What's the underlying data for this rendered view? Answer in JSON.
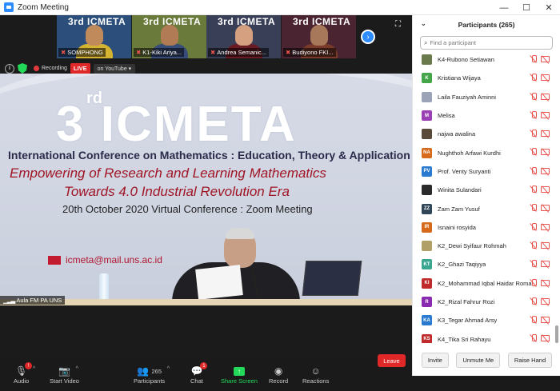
{
  "window": {
    "title": "Zoom Meeting",
    "min": "—",
    "max": "☐",
    "close": "✕"
  },
  "thumbnails": [
    {
      "name": "SOMPHONG",
      "bg": "#2b4f7a",
      "face": "#c08a5a",
      "body": "#d4b232"
    },
    {
      "name": "K1-Kiki Ariya...",
      "bg": "#6a7a3a",
      "face": "#b07b55",
      "body": "#384c7a"
    },
    {
      "name": "Andrea Semanic...",
      "bg": "#3a3f58",
      "face": "#d4a080",
      "body": "#6a1a22"
    },
    {
      "name": "Budiyono FKI...",
      "bg": "#4a2430",
      "face": "#a8785a",
      "body": "#7a3a2a"
    }
  ],
  "thumb_logo": "3rd ICMETA",
  "recording": {
    "label": "Recording",
    "live": "LIVE",
    "stream": "on YouTube"
  },
  "slide": {
    "big": "3",
    "sup": "rd",
    "brand": "ICMETA",
    "line1": "International Conference on Mathematics : Education, Theory & Application",
    "line2": "Empowering of Research and Learning Mathematics",
    "line3": "Towards 4.0 Industrial Revolution Era",
    "line4": "20th October 2020  Virtual Conference : Zoom Meeting",
    "email": "icmeta@mail.uns.ac.id"
  },
  "speaker_tag": "Aula FM PA UNS",
  "toolbar": {
    "audio": "Audio",
    "audio_badge": "!",
    "video": "Start Video",
    "participants": "Participants",
    "participants_count": "265",
    "chat": "Chat",
    "chat_badge": "1",
    "share": "Share Screen",
    "record": "Record",
    "reactions": "Reactions",
    "leave": "Leave"
  },
  "panel": {
    "title": "Participants (265)",
    "search_placeholder": "Find a participant",
    "participants": [
      {
        "name": "K4-Rubono Setiawan",
        "initials": "",
        "color": "#6a7a4a"
      },
      {
        "name": "Kristiana Wijaya",
        "initials": "K",
        "color": "#44a648"
      },
      {
        "name": "Laila Fauziyah Aminni",
        "initials": "",
        "color": "#9aa3b8"
      },
      {
        "name": "Melisa",
        "initials": "M",
        "color": "#9b3fb5"
      },
      {
        "name": "najwa awalina",
        "initials": "",
        "color": "#5a4a3a"
      },
      {
        "name": "Nughthoh Arfawi Kurdhi",
        "initials": "NA",
        "color": "#d66a1a"
      },
      {
        "name": "Prof. Venty Suryanti",
        "initials": "PV",
        "color": "#2a7bd0"
      },
      {
        "name": "Winita Sulandari",
        "initials": "",
        "color": "#2b2b2b"
      },
      {
        "name": "Zam Zam Yusuf",
        "initials": "ZZ",
        "color": "#2f4658"
      },
      {
        "name": "Isnaini rosyida",
        "initials": "IR",
        "color": "#d66a1a"
      },
      {
        "name": "K2_Dewi Syifaur Rohmah",
        "initials": "",
        "color": "#b0a068"
      },
      {
        "name": "K2_Ghazi Taqiyya",
        "initials": "KT",
        "color": "#3aa68f"
      },
      {
        "name": "K2_Mohammad Iqbal Haidar Roma...",
        "initials": "KI",
        "color": "#c02a2a"
      },
      {
        "name": "K2_Rizal Fahrur Rozi",
        "initials": "R",
        "color": "#8a2ab0"
      },
      {
        "name": "K3_Tegar Ahmad Arsy",
        "initials": "KA",
        "color": "#2a7bd0"
      },
      {
        "name": "K4_Tika Sri Rahayu",
        "initials": "KS",
        "color": "#c02a2a"
      }
    ],
    "invite": "Invite",
    "unmute_me": "Unmute Me",
    "raise_hand": "Raise Hand"
  }
}
